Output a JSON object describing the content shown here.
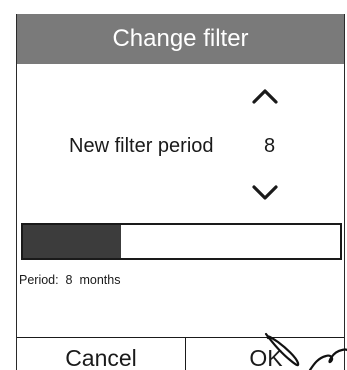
{
  "dialog": {
    "title": "Change filter"
  },
  "stepper": {
    "label": "New filter period",
    "value": "8",
    "up_icon": "chevron-up-icon",
    "down_icon": "chevron-down-icon"
  },
  "progress": {
    "fraction": 0.31
  },
  "period_text": "Period:  8  months",
  "buttons": {
    "cancel_label": "Cancel",
    "ok_label": "OK"
  },
  "colors": {
    "title_bar": "#7a7a7a",
    "progress_fill": "#3c3c3c"
  }
}
